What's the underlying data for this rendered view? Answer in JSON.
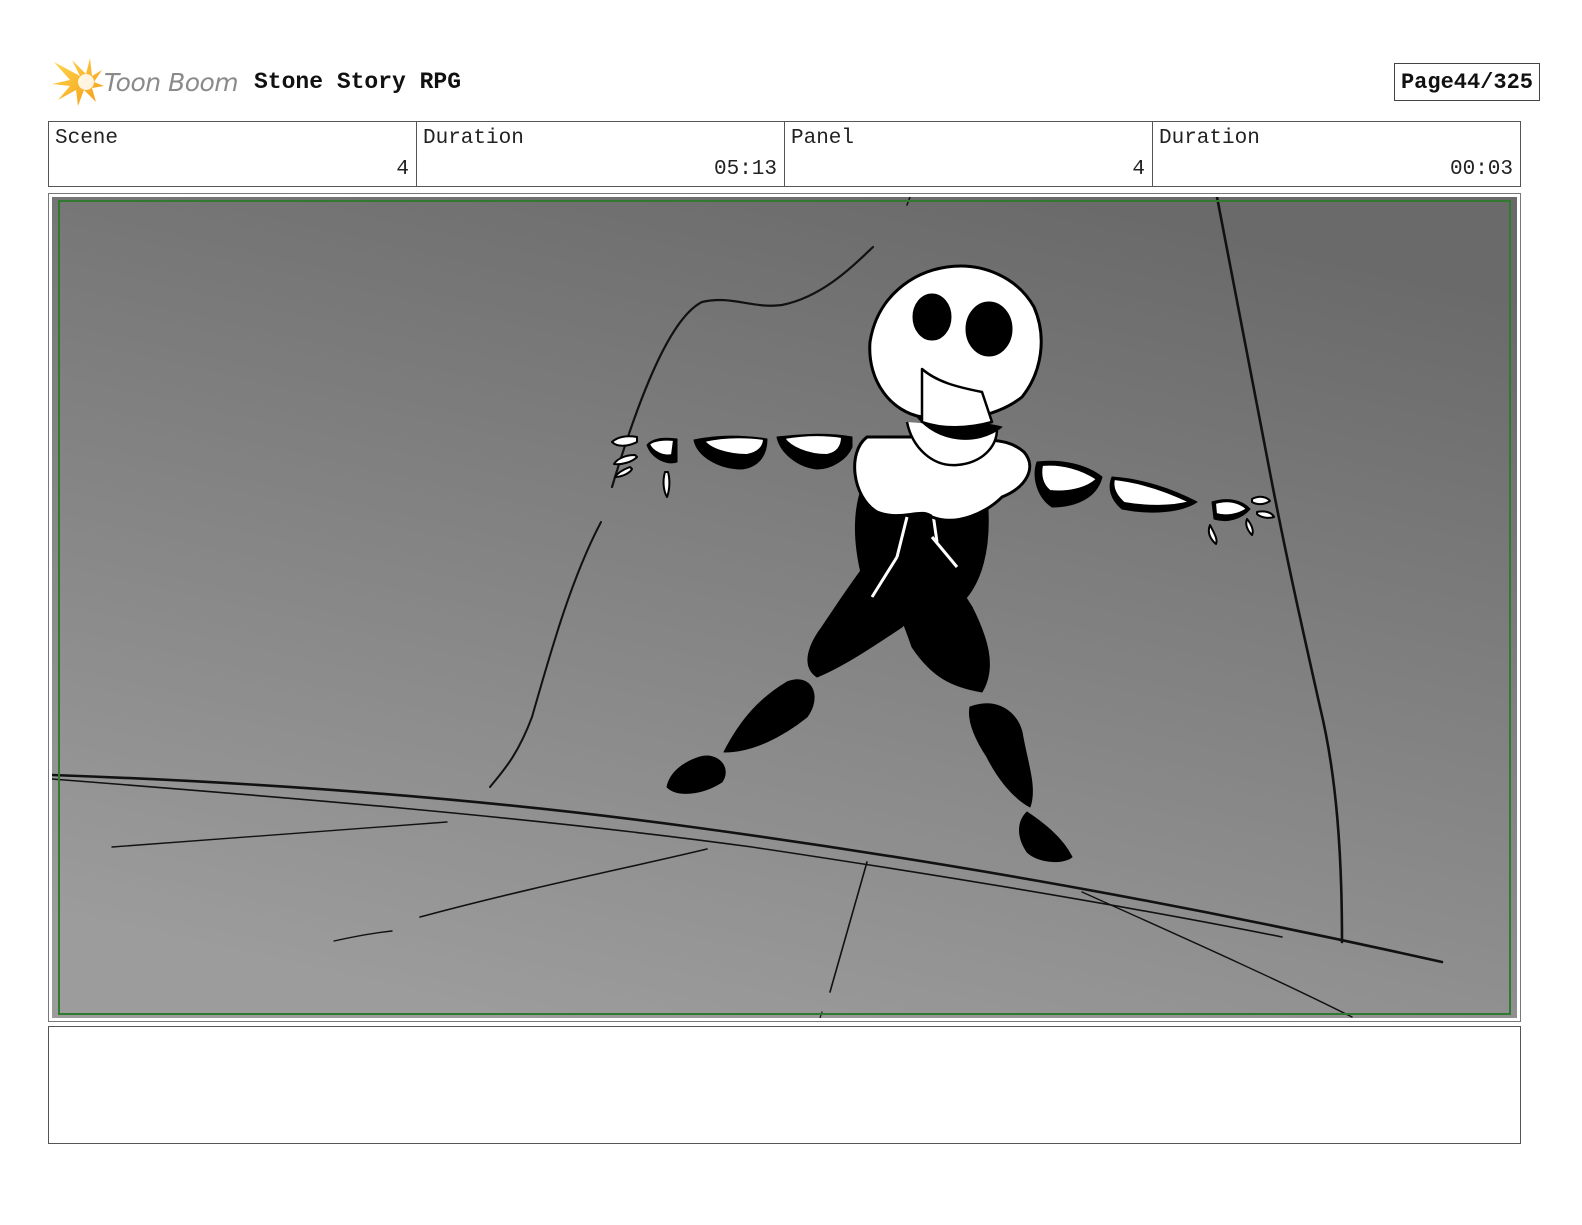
{
  "header": {
    "logo_text": "Toon Boom",
    "project_title": "Stone Story RPG",
    "page_label": "Page",
    "page_value": "44/325"
  },
  "info": {
    "scene_label": "Scene",
    "scene_value": "4",
    "scene_duration_label": "Duration",
    "scene_duration_value": "05:13",
    "panel_label": "Panel",
    "panel_value": "4",
    "panel_duration_label": "Duration",
    "panel_duration_value": "00:03"
  },
  "panel": {
    "image_name": "storyboard-drawing",
    "safe_area_color": "#2f7a2f"
  },
  "notes": {
    "text": ""
  },
  "colors": {
    "logo_orange": "#f5a623",
    "logo_yellow": "#ffd84a",
    "background_top": "#6f6f6f",
    "background_bottom": "#9a9a9a"
  }
}
